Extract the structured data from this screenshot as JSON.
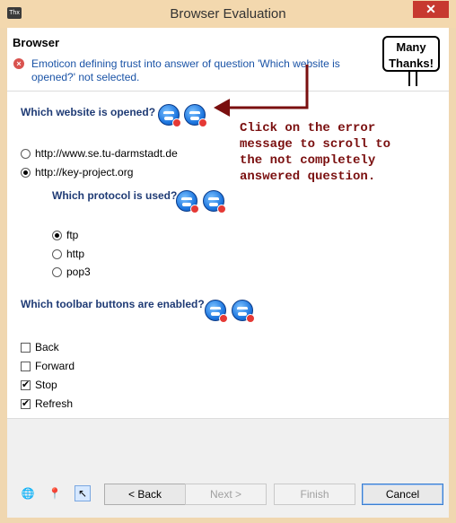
{
  "window": {
    "title": "Browser Evaluation",
    "app_icon_text": "Thx",
    "close_label": "✕"
  },
  "header": {
    "title": "Browser",
    "error_message": "Emoticon defining trust into answer of question 'Which website is opened?' not selected.",
    "banner_line1": "Many",
    "banner_line2": "Thanks!"
  },
  "questions": [
    {
      "text": "Which website is opened?",
      "options": [
        {
          "label": "http://www.se.tu-darmstadt.de",
          "selected": false
        },
        {
          "label": "http://key-project.org",
          "selected": true
        }
      ]
    },
    {
      "text": "Which protocol is used?",
      "options": [
        {
          "label": "ftp",
          "selected": true
        },
        {
          "label": "http",
          "selected": false
        },
        {
          "label": "pop3",
          "selected": false
        }
      ]
    },
    {
      "text": "Which toolbar buttons are enabled?",
      "options": [
        {
          "label": "Back",
          "checked": false
        },
        {
          "label": "Forward",
          "checked": false
        },
        {
          "label": "Stop",
          "checked": true
        },
        {
          "label": "Refresh",
          "checked": true
        }
      ]
    }
  ],
  "annotation": {
    "lines": [
      "Click on the error",
      "message to scroll to",
      "the not completely",
      "answered question."
    ],
    "color": "#7a0f0f"
  },
  "footer": {
    "icons": [
      "globe-icon",
      "pin-icon",
      "cursor-icon"
    ],
    "back_label": "< Back",
    "next_label": "Next >",
    "finish_label": "Finish",
    "cancel_label": "Cancel"
  },
  "colors": {
    "question": "#1f3b75",
    "error_text": "#1a53a6",
    "frame": "#f3d8ae",
    "close": "#c7392f"
  }
}
